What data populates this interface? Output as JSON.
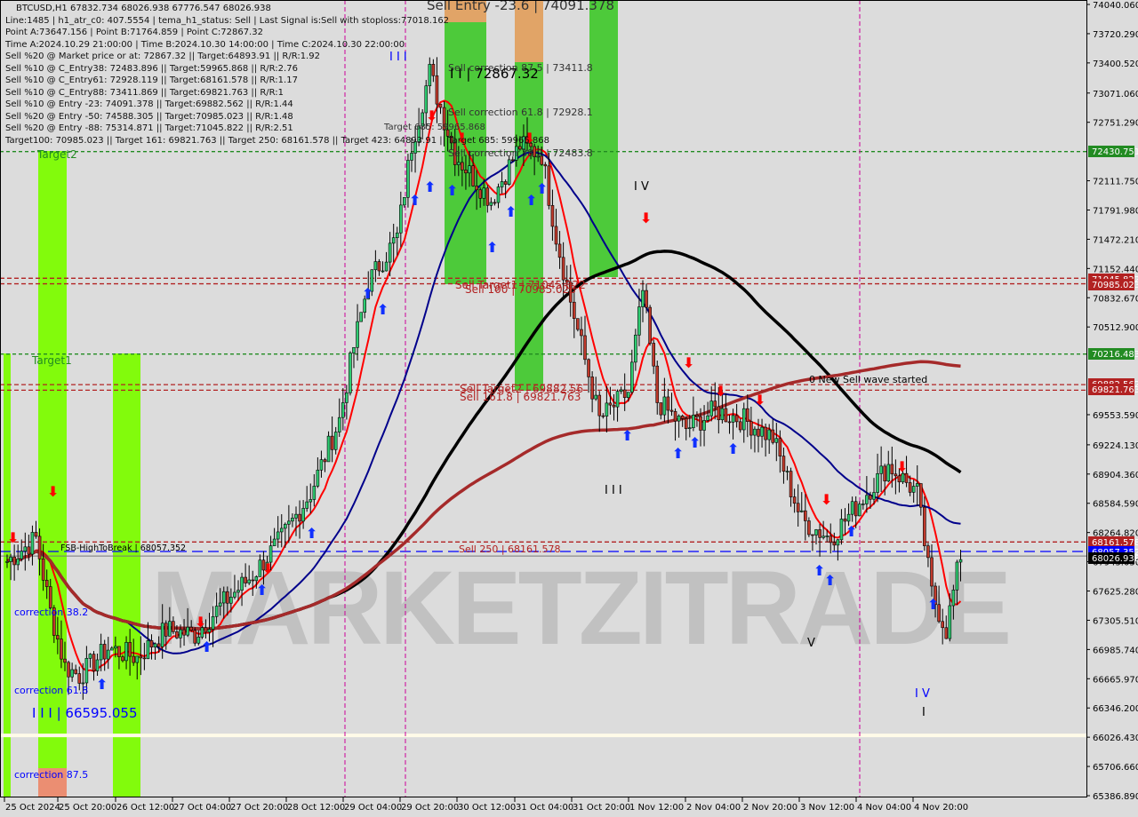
{
  "header": {
    "symbol_line": "BTCUSD,H1  67832.734 68026.938 67776.547 68026.938",
    "lines": [
      "Line:1485 | h1_atr_c0: 407.5554 | tema_h1_status: Sell | Last Signal is:Sell with stoploss:77018.162",
      "Point A:73647.156 | Point B:71764.859 | Point C:72867.32",
      "Time A:2024.10.29 21:00:00 | Time B:2024.10.30 14:00:00 | Time C:2024.10.30 22:00:00",
      "Sell %20 @ Market price or at: 72867.32 || Target:64893.91 || R/R:1.92",
      "Sell %10 @ C_Entry38: 72483.896 || Target:59965.868 || R/R:2.76",
      "Sell %10 @ C_Entry61: 72928.119 || Target:68161.578 || R/R:1.17",
      "Sell %10 @ C_Entry88: 73411.869 || Target:69821.763 || R/R:1",
      "Sell %10 @ Entry -23: 74091.378 || Target:69882.562 || R/R:1.44",
      "Sell %20 @ Entry -50: 74588.305 || Target:70985.023 || R/R:1.48",
      "Sell %20 @ Entry -88: 75314.871 || Target:71045.822 || R/R:2.51",
      "Target100: 70985.023 || Target 161: 69821.763 || Target 250: 68161.578 || Target 423: 64893.91 || Target 685: 59965.868"
    ]
  },
  "colors": {
    "background": "#dcdcdc",
    "bull": "#2ecc71",
    "bear": "#c0392b",
    "zone_green": "#7cfc00",
    "zone_green_dark": "#44c830",
    "zone_orange": "#e0a060",
    "zone_salmon": "#f08878",
    "ema_red": "#ff0000",
    "ma_blue": "#00008b",
    "ma_black": "#000000",
    "ma_brown": "#a52a2a",
    "level_green": "#228b22",
    "level_red": "#b22222",
    "level_blue": "#0000ff",
    "vline_magenta": "#cc0099"
  },
  "watermark": "MARKETZITRADE",
  "chart_data": {
    "type": "candlestick",
    "title": "BTCUSD,H1",
    "ylim": [
      65386.89,
      74040.06
    ],
    "y_ticks": [
      74040.06,
      73720.29,
      73400.52,
      73071.06,
      72751.29,
      72111.75,
      71791.98,
      71472.21,
      71152.44,
      70832.67,
      70512.9,
      69553.59,
      69224.13,
      68904.36,
      68584.59,
      68264.82,
      67945.05,
      67625.28,
      67305.51,
      66985.74,
      66665.97,
      66346.2,
      66026.43,
      65706.66,
      65386.89
    ],
    "x_ticks": [
      "25 Oct 2024",
      "25 Oct 20:00",
      "26 Oct 12:00",
      "27 Oct 04:00",
      "27 Oct 20:00",
      "28 Oct 12:00",
      "29 Oct 04:00",
      "29 Oct 20:00",
      "30 Oct 12:00",
      "31 Oct 04:00",
      "31 Oct 20:00",
      "1 Nov 12:00",
      "2 Nov 04:00",
      "2 Nov 20:00",
      "3 Nov 12:00",
      "4 Nov 04:00",
      "4 Nov 20:00"
    ],
    "price_badges": [
      {
        "value": "72430.751",
        "price": 72430.751,
        "color": "#228b22"
      },
      {
        "value": "71045.822",
        "price": 71045.822,
        "color": "#b22222"
      },
      {
        "value": "70985.023",
        "price": 70985.023,
        "color": "#b22222"
      },
      {
        "value": "70216.483",
        "price": 70216.483,
        "color": "#228b22"
      },
      {
        "value": "69882.562",
        "price": 69882.562,
        "color": "#b22222"
      },
      {
        "value": "69821.763",
        "price": 69821.763,
        "color": "#b22222"
      },
      {
        "value": "68161.578",
        "price": 68161.578,
        "color": "#b22222"
      },
      {
        "value": "68057.352",
        "price": 68057.352,
        "color": "#0000ff"
      },
      {
        "value": "68026.938",
        "price": 68026.938,
        "color": "#000000"
      }
    ],
    "levels": [
      {
        "price": 72430.751,
        "color": "#228b22",
        "style": "dotted",
        "label": "Target2"
      },
      {
        "price": 71045.822,
        "color": "#b22222",
        "style": "dashed",
        "label": "Sell Target1 | 71045.822"
      },
      {
        "price": 70985.023,
        "color": "#b22222",
        "style": "dashed",
        "label": "Sell 100 | 70985.023"
      },
      {
        "price": 70216.483,
        "color": "#228b22",
        "style": "dotted",
        "label": "Target1"
      },
      {
        "price": 69882.562,
        "color": "#b22222",
        "style": "dashed",
        "label": "Sell Target2 | 69882.56"
      },
      {
        "price": 69821.763,
        "color": "#b22222",
        "style": "dashed",
        "label": "Sell 161.8 | 69821.763"
      },
      {
        "price": 68161.578,
        "color": "#b22222",
        "style": "dashed",
        "label": "Sell 250 | 68161.578"
      },
      {
        "price": 68057.352,
        "color": "#0000ff",
        "style": "longdash",
        "label": "FSB-HighToBreak | 68057.352"
      }
    ],
    "annotations": [
      {
        "text": "Sell Entry -23.6 | 74091.378",
        "color": "#333333"
      },
      {
        "text": "Sell correction 87.5 | 73411.8",
        "color": "#333333"
      },
      {
        "text": "I I | 72867.32",
        "color": "#000000"
      },
      {
        "text": "Sell correction 61.8 | 72928.1",
        "color": "#333333"
      },
      {
        "text": "Sell correction 38.2 | 72483.8",
        "color": "#333333"
      },
      {
        "text": "Target 685: 59965.868",
        "color": "#333333"
      },
      {
        "text": "0 New Sell wave started",
        "color": "#000000"
      },
      {
        "text": "correction 38.2",
        "color": "#0000ff"
      },
      {
        "text": "correction 61.8",
        "color": "#0000ff"
      },
      {
        "text": "I I I | 66595.055",
        "color": "#0000ff"
      },
      {
        "text": "correction 87.5",
        "color": "#0000ff"
      },
      {
        "text": "I I I",
        "color": "#0000ff"
      },
      {
        "text": "I V",
        "color": "#000000"
      },
      {
        "text": "I I I",
        "color": "#000000"
      },
      {
        "text": "V",
        "color": "#000000"
      },
      {
        "text": "I V",
        "color": "#0000ff"
      },
      {
        "text": "I",
        "color": "#000000"
      }
    ],
    "last_ohlc": {
      "open": 67832.734,
      "high": 68026.938,
      "low": 67776.547,
      "close": 68026.938
    },
    "key_points": {
      "A": 73647.156,
      "B": 71764.859,
      "C": 72867.32
    },
    "approx_close_path": [
      [
        "25 Oct 00:00",
        67950
      ],
      [
        "25 Oct 08:00",
        68200
      ],
      [
        "25 Oct 12:00",
        67400
      ],
      [
        "25 Oct 16:00",
        66800
      ],
      [
        "25 Oct 20:00",
        66700
      ],
      [
        "26 Oct 04:00",
        67000
      ],
      [
        "26 Oct 12:00",
        66900
      ],
      [
        "26 Oct 20:00",
        67200
      ],
      [
        "27 Oct 04:00",
        67150
      ],
      [
        "27 Oct 12:00",
        67500
      ],
      [
        "27 Oct 20:00",
        67800
      ],
      [
        "28 Oct 04:00",
        68200
      ],
      [
        "28 Oct 12:00",
        68700
      ],
      [
        "28 Oct 20:00",
        69500
      ],
      [
        "29 Oct 00:00",
        70300
      ],
      [
        "29 Oct 04:00",
        71000
      ],
      [
        "29 Oct 12:00",
        71500
      ],
      [
        "29 Oct 16:00",
        72500
      ],
      [
        "29 Oct 21:00",
        73300
      ],
      [
        "30 Oct 04:00",
        72400
      ],
      [
        "30 Oct 14:00",
        71900
      ],
      [
        "30 Oct 22:00",
        72500
      ],
      [
        "31 Oct 04:00",
        72400
      ],
      [
        "31 Oct 08:00",
        71500
      ],
      [
        "31 Oct 12:00",
        70800
      ],
      [
        "31 Oct 20:00",
        69500
      ],
      [
        "1 Nov 04:00",
        69800
      ],
      [
        "1 Nov 08:00",
        70900
      ],
      [
        "1 Nov 12:00",
        69700
      ],
      [
        "1 Nov 20:00",
        69400
      ],
      [
        "2 Nov 04:00",
        69600
      ],
      [
        "2 Nov 12:00",
        69500
      ],
      [
        "2 Nov 20:00",
        69300
      ],
      [
        "3 Nov 04:00",
        68400
      ],
      [
        "3 Nov 12:00",
        68200
      ],
      [
        "3 Nov 20:00",
        68600
      ],
      [
        "4 Nov 04:00",
        69000
      ],
      [
        "4 Nov 12:00",
        68700
      ],
      [
        "4 Nov 16:00",
        67600
      ],
      [
        "4 Nov 20:00",
        67200
      ],
      [
        "5 Nov 00:00",
        68027
      ]
    ],
    "moving_averages": [
      {
        "name": "ema-fast",
        "color": "#ff0000"
      },
      {
        "name": "ma-mid",
        "color": "#00008b"
      },
      {
        "name": "ma-slow",
        "color": "#000000"
      },
      {
        "name": "ma-long",
        "color": "#a52a2a"
      }
    ]
  }
}
